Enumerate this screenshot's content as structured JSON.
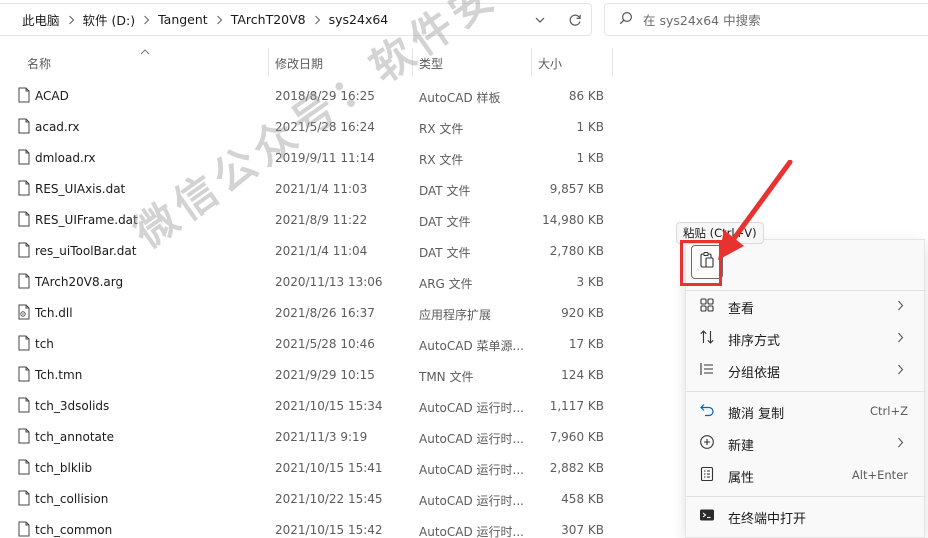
{
  "address_bar": {
    "crumbs": [
      "此电脑",
      "软件 (D:)",
      "Tangent",
      "TArchT20V8",
      "sys24x64"
    ]
  },
  "search": {
    "placeholder": "在 sys24x64 中搜索"
  },
  "columns": {
    "name": "名称",
    "date": "修改日期",
    "type": "类型",
    "size": "大小"
  },
  "files": [
    {
      "name": "ACAD",
      "date": "2018/8/29 16:25",
      "type": "AutoCAD 样板",
      "size": "86 KB",
      "icon": "file-icon"
    },
    {
      "name": "acad.rx",
      "date": "2021/5/28 16:24",
      "type": "RX 文件",
      "size": "1 KB",
      "icon": "file-icon"
    },
    {
      "name": "dmload.rx",
      "date": "2019/9/11 11:14",
      "type": "RX 文件",
      "size": "1 KB",
      "icon": "file-icon"
    },
    {
      "name": "RES_UIAxis.dat",
      "date": "2021/1/4 11:03",
      "type": "DAT 文件",
      "size": "9,857 KB",
      "icon": "file-icon"
    },
    {
      "name": "RES_UIFrame.dat",
      "date": "2021/8/9 11:22",
      "type": "DAT 文件",
      "size": "14,980 KB",
      "icon": "file-icon"
    },
    {
      "name": "res_uiToolBar.dat",
      "date": "2021/1/4 11:04",
      "type": "DAT 文件",
      "size": "2,780 KB",
      "icon": "file-icon"
    },
    {
      "name": "TArch20V8.arg",
      "date": "2020/11/13 13:06",
      "type": "ARG 文件",
      "size": "3 KB",
      "icon": "file-icon"
    },
    {
      "name": "Tch.dll",
      "date": "2021/8/26 16:37",
      "type": "应用程序扩展",
      "size": "920 KB",
      "icon": "dll-file-icon"
    },
    {
      "name": "tch",
      "date": "2021/5/28 10:46",
      "type": "AutoCAD 菜单源...",
      "size": "17 KB",
      "icon": "file-icon"
    },
    {
      "name": "Tch.tmn",
      "date": "2021/9/29 10:15",
      "type": "TMN 文件",
      "size": "124 KB",
      "icon": "file-icon"
    },
    {
      "name": "tch_3dsolids",
      "date": "2021/10/15 15:34",
      "type": "AutoCAD 运行时...",
      "size": "1,117 KB",
      "icon": "file-icon"
    },
    {
      "name": "tch_annotate",
      "date": "2021/11/3 9:19",
      "type": "AutoCAD 运行时...",
      "size": "7,960 KB",
      "icon": "file-icon"
    },
    {
      "name": "tch_blklib",
      "date": "2021/10/15 15:41",
      "type": "AutoCAD 运行时...",
      "size": "2,882 KB",
      "icon": "file-icon"
    },
    {
      "name": "tch_collision",
      "date": "2021/10/22 15:45",
      "type": "AutoCAD 运行时...",
      "size": "458 KB",
      "icon": "file-icon"
    },
    {
      "name": "tch_common",
      "date": "2021/10/15 15:42",
      "type": "AutoCAD 运行时...",
      "size": "307 KB",
      "icon": "file-icon"
    }
  ],
  "context_menu": {
    "tooltip": "粘贴 (Ctrl+V)",
    "items": [
      {
        "label": "查看",
        "icon": "grid-view-icon",
        "shortcut": "",
        "submenu": true
      },
      {
        "label": "排序方式",
        "icon": "sort-icon",
        "shortcut": "",
        "submenu": true
      },
      {
        "label": "分组依据",
        "icon": "group-list-icon",
        "shortcut": "",
        "submenu": true
      },
      {
        "label": "撤消 复制",
        "icon": "undo-icon",
        "shortcut": "Ctrl+Z",
        "submenu": false
      },
      {
        "label": "新建",
        "icon": "new-plus-icon",
        "shortcut": "",
        "submenu": true
      },
      {
        "label": "属性",
        "icon": "properties-icon",
        "shortcut": "Alt+Enter",
        "submenu": false
      },
      {
        "label": "在终端中打开",
        "icon": "terminal-icon",
        "shortcut": "",
        "submenu": false
      }
    ]
  },
  "watermark": "微信公众号：软件安装大神",
  "colors": {
    "highlight": "#e8322f",
    "accent": "#0067c0"
  }
}
